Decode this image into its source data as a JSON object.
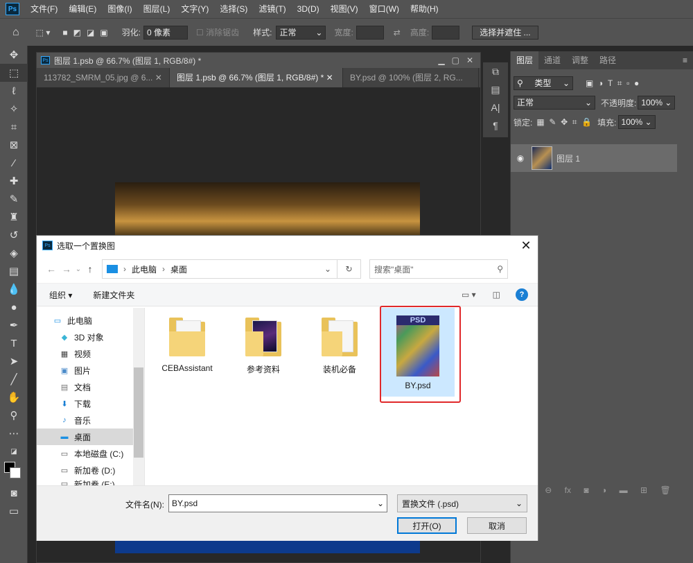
{
  "app": {
    "logo": "Ps"
  },
  "menu": [
    "文件(F)",
    "编辑(E)",
    "图像(I)",
    "图层(L)",
    "文字(Y)",
    "选择(S)",
    "滤镜(T)",
    "3D(D)",
    "视图(V)",
    "窗口(W)",
    "帮助(H)"
  ],
  "options": {
    "feather_label": "羽化:",
    "feather_value": "0 像素",
    "antialias_label": "消除锯齿",
    "style_label": "样式:",
    "style_value": "正常",
    "width_label": "宽度:",
    "height_label": "高度:",
    "select_mask_button": "选择并遮住 ..."
  },
  "document": {
    "window_title": "图层 1.psb @ 66.7% (图层 1, RGB/8#) *",
    "tabs": [
      {
        "label": "113782_SMRM_05.jpg @ 6..."
      },
      {
        "label": "图层 1.psb @ 66.7% (图层 1, RGB/8#) *"
      },
      {
        "label": "BY.psd @ 100% (图层 2, RG..."
      }
    ]
  },
  "layers_panel": {
    "tabs": [
      "图层",
      "通道",
      "调整",
      "路径"
    ],
    "filter_kind": "类型",
    "blend_mode": "正常",
    "opacity_label": "不透明度:",
    "opacity_value": "100%",
    "lock_label": "锁定:",
    "fill_label": "填充:",
    "fill_value": "100%",
    "layers": [
      {
        "name": "图层 1"
      }
    ]
  },
  "dialog": {
    "title": "选取一个置换图",
    "breadcrumb": [
      "此电脑",
      "桌面"
    ],
    "search_placeholder": "搜索\"桌面\"",
    "organize": "组织",
    "new_folder": "新建文件夹",
    "tree": [
      {
        "label": "此电脑"
      },
      {
        "label": "3D 对象"
      },
      {
        "label": "视频"
      },
      {
        "label": "图片"
      },
      {
        "label": "文档"
      },
      {
        "label": "下载"
      },
      {
        "label": "音乐"
      },
      {
        "label": "桌面"
      },
      {
        "label": "本地磁盘 (C:)"
      },
      {
        "label": "新加卷 (D:)"
      },
      {
        "label": "新加卷 (E:)"
      }
    ],
    "files": [
      {
        "name": "CEBAssistant"
      },
      {
        "name": "参考资料"
      },
      {
        "name": "装机必备"
      },
      {
        "name": "BY.psd",
        "badge": "PSD"
      }
    ],
    "filename_label": "文件名(N):",
    "filename_value": "BY.psd",
    "filetype_value": "置换文件 (.psd)",
    "open_button": "打开(O)",
    "cancel_button": "取消"
  }
}
